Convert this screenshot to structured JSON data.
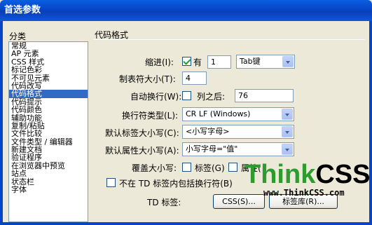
{
  "window": {
    "title": "首选参数"
  },
  "sidebar": {
    "header": "分类",
    "items": [
      "常规",
      "AP 元素",
      "CSS 样式",
      "标记色彩",
      "不可见元素",
      "代码改写",
      "代码格式",
      "代码提示",
      "代码颜色",
      "辅助功能",
      "复制/粘贴",
      "文件比较",
      "文件类型 / 编辑器",
      "新建文档",
      "验证程序",
      "在浏览器中预览",
      "站点",
      "状态栏",
      "字体"
    ],
    "selected": "代码格式"
  },
  "section": {
    "title": "代码格式"
  },
  "indent": {
    "label": "缩进(I):",
    "checkbox_label": "有",
    "checked": true,
    "value": "1",
    "unit": "Tab键"
  },
  "tab_size": {
    "label": "制表符大小(T):",
    "value": "4"
  },
  "wrap": {
    "label": "自动换行(W):",
    "checkbox_label": "列之后:",
    "checked": false,
    "value": "76"
  },
  "line_break": {
    "label": "换行符类型(L):",
    "value": "CR LF (Windows)"
  },
  "tag_case": {
    "label": "默认标签大小写(C):",
    "value": "<小写字母>"
  },
  "attr_case": {
    "label": "默认属性大小写(A):",
    "value": "小写字母=\"值\""
  },
  "override": {
    "label": "覆盖大小写:",
    "tag_label": "标签(G)",
    "attr_label": "属性(",
    "tag_checked": false,
    "attr_checked": false
  },
  "td_option": {
    "label": "不在 TD 标签内包括换行符(B)",
    "checked": false
  },
  "td_tag": {
    "label": "TD 标签:",
    "css_button": "CSS(S)...",
    "tag_lib_button": "标签库(R)..."
  },
  "watermark": {
    "think": "Think",
    "css": "CSS",
    "url": "www.ThinkCSS.com"
  }
}
